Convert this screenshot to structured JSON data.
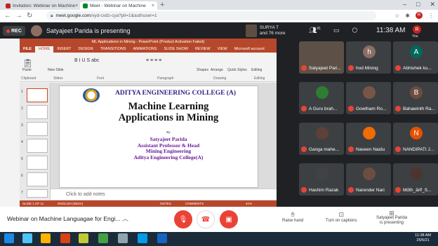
{
  "browser": {
    "tabs": [
      {
        "title": "Invitation: Webinar on Machine",
        "favicon_color": "#c5221f"
      },
      {
        "title": "Meet - Webinar on Machine",
        "favicon_color": "#00832d"
      }
    ],
    "new_tab": "+",
    "url_host": "meet.google.com",
    "url_path": "/xyd-cxdz-cya?pli=1&authuser=1",
    "profile_initial": "R"
  },
  "meet_top": {
    "rec_label": "REC",
    "presenting_text": "Satyajeet Parida is presenting",
    "surya_name": "SURYA T",
    "surya_more": "and 76 more",
    "participants_count": "91",
    "clock": "11:38 AM",
    "you_initial": "R",
    "you_label": "You"
  },
  "ppt": {
    "window_title": "ML Applications in Mining - PowerPoint (Product Activation Failed)",
    "menu": [
      "FILE",
      "HOME",
      "INSERT",
      "DESIGN",
      "TRANSITIONS",
      "ANIMATIONS",
      "SLIDE SHOW",
      "REVIEW",
      "VIEW",
      "Microsoft account"
    ],
    "ribbon_groups": [
      "Clipboard",
      "Slides",
      "Font",
      "Paragraph",
      "Drawing",
      "Editing"
    ],
    "ribbon_buttons": {
      "paste": "Paste",
      "new_slide": "New Slide",
      "shapes": "Shapes",
      "arrange": "Arrange",
      "quick_styles": "Quick Styles",
      "editing": "Editing"
    },
    "thumb_numbers": [
      "1",
      "2",
      "3",
      "4",
      "5",
      "6",
      "7"
    ],
    "slide": {
      "college": "ADITYA ENGINEERING COLLEGE (A)",
      "title_line1": "Machine Learning",
      "title_line2": "Applications in Mining",
      "by": "By",
      "author_lines": [
        "Satyajeet Parida",
        "Assistant Professor & Head",
        "Mining Engineering",
        "Aditya Engineering College(A)"
      ]
    },
    "notes_placeholder": "Click to add notes",
    "status": {
      "slide_of": "SLIDE 1 OF 11",
      "language": "ENGLISH (INDIA)",
      "notes": "NOTES",
      "comments": "COMMENTS",
      "zoom": "41%"
    }
  },
  "participants": [
    {
      "name": "Satyajeet Pari...",
      "avatar": "",
      "color": "#5d5147"
    },
    {
      "name": "hod Mining",
      "avatar": "h",
      "color": "#8d6e63"
    },
    {
      "name": "Abhishek ku...",
      "avatar": "A",
      "color": "#00695c"
    },
    {
      "name": "A Guru brah...",
      "avatar": "",
      "color": "#2e7d32"
    },
    {
      "name": "Gowtham Ro...",
      "avatar": "",
      "color": "#795548"
    },
    {
      "name": "Bahawinth Ra...",
      "avatar": "B",
      "color": "#6d4c41"
    },
    {
      "name": "Ganga mahe...",
      "avatar": "",
      "color": "#5d4037"
    },
    {
      "name": "Naveen Naidu",
      "avatar": "",
      "color": "#ef6c00"
    },
    {
      "name": "NANDIPATI J...",
      "avatar": "N",
      "color": "#e65100"
    },
    {
      "name": "Hashim Razak",
      "avatar": "",
      "color": "#424242"
    },
    {
      "name": "Narender Nari",
      "avatar": "",
      "color": "#6d4c41"
    },
    {
      "name": "Műth_ărǐf_S...",
      "avatar": "",
      "color": "#4e342e"
    }
  ],
  "bottom": {
    "meeting_title": "Webinar on Machine Languagae for Engi...",
    "raise_hand": "Raise hand",
    "captions": "Turn on captions",
    "presenting_line1": "Satyajeet Parida",
    "presenting_line2": "is presenting"
  },
  "taskbar": {
    "time": "11:38 AM",
    "date": "25/5/21"
  },
  "colors": {
    "ppt_accent": "#b7472a",
    "meet_red": "#ea4335",
    "slide_blue": "#2e1d80",
    "author_purple": "#6a1b9a"
  }
}
